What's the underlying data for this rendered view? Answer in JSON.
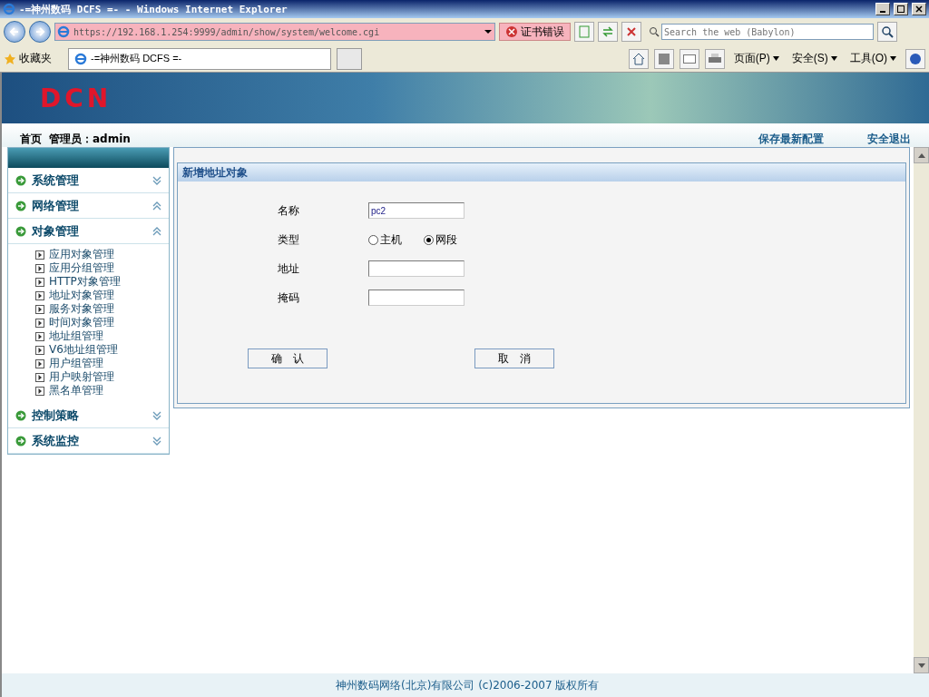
{
  "window": {
    "title": "-=神州数码 DCFS =- - Windows Internet Explorer"
  },
  "browser": {
    "address": "https://192.168.1.254:9999/admin/show/system/welcome.cgi",
    "cert_error": "证书错误",
    "search_placeholder": "Search the web (Babylon)",
    "favorites": "收藏夹",
    "tab_title": "-=神州数码 DCFS =-",
    "menus": [
      "页面(P)",
      "安全(S)",
      "工具(O)"
    ]
  },
  "header": {
    "logo": "DCN",
    "home": "首页",
    "admin": "管理员：admin",
    "links": [
      "保存最新配置",
      "安全退出"
    ]
  },
  "sidebar": {
    "sections": [
      {
        "label": "系统管理",
        "expanded": false
      },
      {
        "label": "网络管理",
        "expanded": true
      },
      {
        "label": "对象管理",
        "expanded": true,
        "items": [
          "应用对象管理",
          "应用分组管理",
          "HTTP对象管理",
          "地址对象管理",
          "服务对象管理",
          "时间对象管理",
          "地址组管理",
          "V6地址组管理",
          "用户组管理",
          "用户映射管理",
          "黑名单管理"
        ]
      },
      {
        "label": "控制策略",
        "expanded": false
      },
      {
        "label": "系统监控",
        "expanded": false
      }
    ]
  },
  "form": {
    "title": "新增地址对象",
    "fields": [
      {
        "kind": "text",
        "label": "名称",
        "value": "pc2"
      },
      {
        "kind": "radio",
        "label": "类型",
        "options": [
          {
            "label": "主机",
            "selected": false
          },
          {
            "label": "网段",
            "selected": true
          }
        ]
      },
      {
        "kind": "text",
        "label": "地址"
      },
      {
        "kind": "text",
        "label": "掩码"
      }
    ],
    "buttons": [
      "确　认",
      "取　消"
    ]
  },
  "footer": "神州数码网络(北京)有限公司 (c)2006-2007 版权所有"
}
